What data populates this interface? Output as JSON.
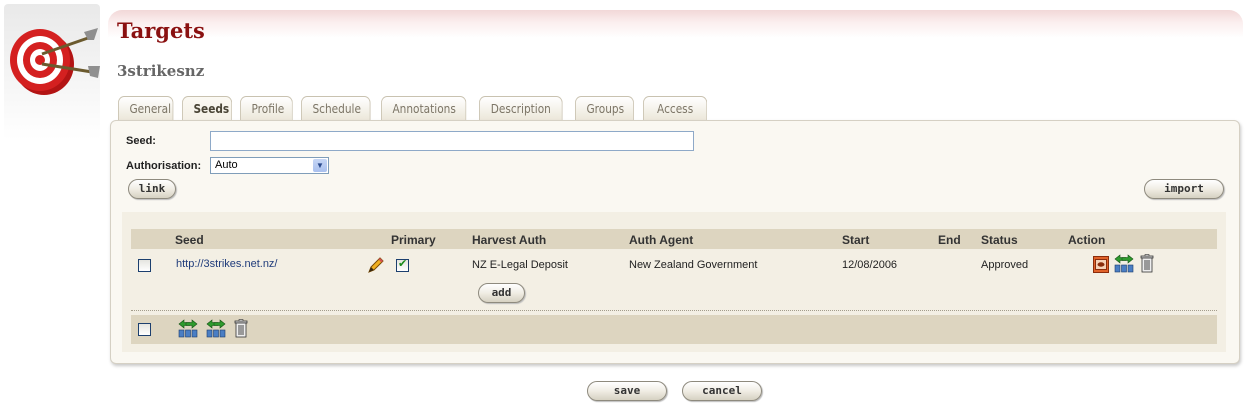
{
  "header": {
    "title": "Targets",
    "target_name": "3strikesnz"
  },
  "tabs": [
    {
      "label": "General",
      "active": false
    },
    {
      "label": "Seeds",
      "active": true
    },
    {
      "label": "Profile",
      "active": false
    },
    {
      "label": "Schedule",
      "active": false
    },
    {
      "label": "Annotations",
      "active": false
    },
    {
      "label": "Description",
      "active": false
    },
    {
      "label": "Groups",
      "active": false
    },
    {
      "label": "Access",
      "active": false
    }
  ],
  "form": {
    "seed_label": "Seed:",
    "seed_value": "",
    "authorisation_label": "Authorisation:",
    "authorisation_value": "Auto",
    "link_button": "link",
    "import_button": "import"
  },
  "table": {
    "columns": [
      "Seed",
      "Primary",
      "Harvest Auth",
      "Auth Agent",
      "Start",
      "End",
      "Status",
      "Action"
    ],
    "rows": [
      {
        "seed": "http://3strikes.net.nz/",
        "primary": true,
        "harvest_auth": "NZ E-Legal Deposit",
        "auth_agent": "New Zealand Government",
        "start": "12/08/2006",
        "end": "",
        "status": "Approved",
        "add_button": "add"
      }
    ]
  },
  "actions": {
    "save": "save",
    "cancel": "cancel"
  },
  "icons": [
    "target-logo-icon",
    "edit-pencil-icon",
    "view-icon",
    "link-icon",
    "delete-icon"
  ],
  "colors": {
    "title": "#8a1010",
    "header_band": "#f2d8d8",
    "table_header": "#ddd5c0",
    "panel": "#faf8f2",
    "link": "#1f3b7a"
  }
}
